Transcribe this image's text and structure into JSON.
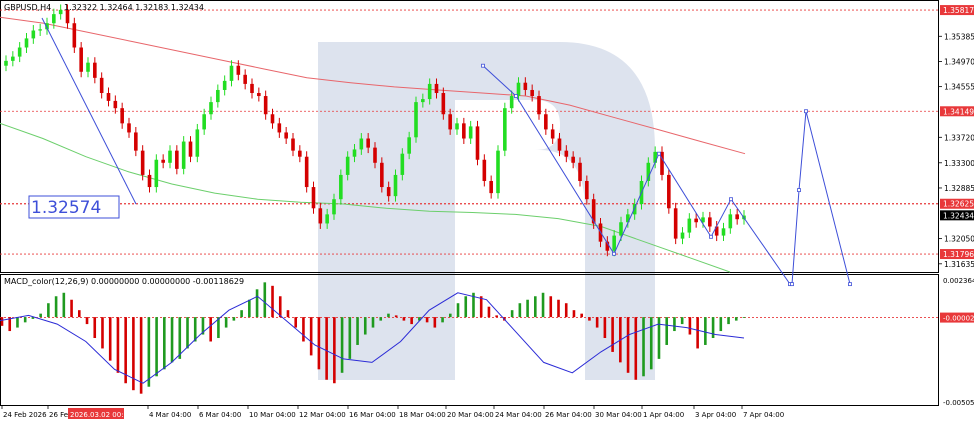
{
  "header": {
    "symbol": "GBPUSD,H4",
    "ohlc": "1.32322 1.32464 1.32183 1.32434",
    "big_price_label": "1.32574"
  },
  "macd_header": "MACD_color(12,26,9) 0.00000000 0.00000000 -0.00118629",
  "x_axis": {
    "labels": [
      "24 Feb 2026",
      "26 Feb",
      "2026.03.02 00:00",
      "4 Mar 04:00",
      "6 Mar 04:00",
      "10 Mar 04:00",
      "12 Mar 04:00",
      "16 Mar 04:00",
      "18 Mar 04:00",
      "20 Mar 04:00",
      "24 Mar 04:00",
      "26 Mar 04:00",
      "30 Mar 04:00",
      "1 Apr 04:00",
      "3 Apr 04:00",
      "7 Apr 04:00"
    ]
  },
  "price_axis": {
    "ticks": [
      "1.35385",
      "1.34970",
      "1.34555",
      "1.33720",
      "1.33300",
      "1.32885",
      "1.32050",
      "1.31635"
    ],
    "tagged": [
      {
        "value": "1.35817",
        "bg": "#e8383a"
      },
      {
        "value": "1.34149",
        "bg": "#e8383a"
      },
      {
        "value": "1.32625",
        "bg": "#e8383a"
      },
      {
        "value": "1.32434",
        "bg": "#000000"
      },
      {
        "value": "1.31796",
        "bg": "#e8383a"
      }
    ]
  },
  "macd_axis": {
    "ticks": [
      "0.0023644",
      "-0.0050508"
    ],
    "tagged": [
      {
        "value": "-0.000026",
        "bg": "#e8383a"
      }
    ]
  },
  "colors": {
    "bull": "#22dd22",
    "bear": "#d40000",
    "ma_slow": "#e8666b",
    "ma_fast": "#6ccf6c",
    "forecast": "#3e4fd8",
    "level": "#e8383a",
    "signal": "#2b2bd6",
    "watermark": "#dde3ee"
  },
  "chart_data": {
    "type": "candlestick",
    "timeframe": "H4",
    "ylim": [
      1.315,
      1.3595
    ],
    "levels": [
      1.35817,
      1.34149,
      1.32625,
      1.31796
    ],
    "current_price": 1.32434,
    "closes": [
      1.3498,
      1.3505,
      1.352,
      1.3535,
      1.3548,
      1.355,
      1.356,
      1.3575,
      1.3582,
      1.356,
      1.352,
      1.348,
      1.3495,
      1.347,
      1.3445,
      1.3432,
      1.342,
      1.3395,
      1.338,
      1.335,
      1.331,
      1.329,
      1.3335,
      1.333,
      1.335,
      1.332,
      1.3365,
      1.334,
      1.3385,
      1.341,
      1.343,
      1.345,
      1.3465,
      1.349,
      1.3475,
      1.346,
      1.3445,
      1.344,
      1.341,
      1.3395,
      1.338,
      1.337,
      1.335,
      1.334,
      1.329,
      1.3255,
      1.323,
      1.3245,
      1.327,
      1.331,
      1.334,
      1.3352,
      1.337,
      1.3355,
      1.333,
      1.329,
      1.3275,
      1.331,
      1.3345,
      1.3372,
      1.343,
      1.3435,
      1.346,
      1.3445,
      1.341,
      1.3385,
      1.3395,
      1.337,
      1.339,
      1.3335,
      1.33,
      1.328,
      1.335,
      1.342,
      1.344,
      1.3462,
      1.345,
      1.344,
      1.341,
      1.3385,
      1.337,
      1.335,
      1.334,
      1.333,
      1.33,
      1.327,
      1.323,
      1.32,
      1.3185,
      1.321,
      1.3232,
      1.3245,
      1.3262,
      1.33,
      1.333,
      1.3348,
      1.331,
      1.3255,
      1.3205,
      1.3215,
      1.3238,
      1.3232,
      1.324,
      1.3225,
      1.321,
      1.3222,
      1.3245,
      1.3237,
      1.3243
    ],
    "ma_slow": [
      1.357,
      1.356,
      1.3545,
      1.353,
      1.3515,
      1.35,
      1.3485,
      1.347,
      1.3462,
      1.3455,
      1.345,
      1.3445,
      1.344,
      1.3425,
      1.3405,
      1.3385,
      1.3365,
      1.3345
    ],
    "ma_fast": [
      1.3395,
      1.337,
      1.334,
      1.3315,
      1.3295,
      1.328,
      1.327,
      1.3265,
      1.3262,
      1.3255,
      1.325,
      1.3248,
      1.3245,
      1.3238,
      1.3225,
      1.32,
      1.3175,
      1.315
    ],
    "forecast": [
      {
        "x": "20 Mar 04:00",
        "y": 1.349
      },
      {
        "x": "24 Mar 04:00",
        "y": 1.344
      },
      {
        "x": "30 Mar 04:00",
        "y": 1.318
      },
      {
        "x": "1 Apr 04:00",
        "y": 1.3345
      },
      {
        "x": "3 Apr 04:00",
        "y": 1.3208
      },
      {
        "x": "7 Apr 04:00",
        "y": 1.327
      },
      {
        "x": "8 Apr",
        "y": 1.313
      },
      {
        "x": "9 Apr",
        "y": 1.313
      },
      {
        "x": "9 Apr",
        "y": 1.3285
      },
      {
        "x": "9 Apr",
        "y": 1.3415
      },
      {
        "x": "10 Apr",
        "y": 1.313
      }
    ],
    "macd": {
      "ylim": [
        -0.0050508,
        0.0023644
      ],
      "hist": [
        -0.0005,
        -0.0008,
        -0.0006,
        -0.0003,
        -0.0001,
        0.0002,
        0.0008,
        0.0012,
        0.0014,
        0.001,
        0.0004,
        -0.0004,
        -0.0012,
        -0.0018,
        -0.0025,
        -0.0032,
        -0.0038,
        -0.0042,
        -0.0044,
        -0.004,
        -0.0034,
        -0.003,
        -0.0026,
        -0.0024,
        -0.0018,
        -0.0014,
        -0.001,
        -0.0014,
        -0.0012,
        -0.0006,
        -0.0002,
        0.0004,
        0.001,
        0.0016,
        0.002,
        0.0018,
        0.0012,
        0.0004,
        -0.0006,
        -0.0014,
        -0.0022,
        -0.003,
        -0.0036,
        -0.0038,
        -0.0032,
        -0.0024,
        -0.0016,
        -0.001,
        -0.0006,
        -0.0002,
        0.0002,
        0.0001,
        -0.0002,
        -0.0004,
        -0.0002,
        -0.0003,
        -0.0006,
        -0.0003,
        0.0002,
        0.0008,
        0.0012,
        0.0014,
        0.0012,
        0.0006,
        0.0001,
        -0.0002,
        0.0004,
        0.0008,
        0.001,
        0.0012,
        0.0014,
        0.0012,
        0.001,
        0.0008,
        0.0004,
        0.0002,
        -0.0002,
        -0.0006,
        -0.0012,
        -0.002,
        -0.0026,
        -0.0032,
        -0.0036,
        -0.0034,
        -0.003,
        -0.0024,
        -0.0016,
        -0.0008,
        -0.0004,
        -0.001,
        -0.0018,
        -0.0016,
        -0.0012,
        -0.0008,
        -0.0004,
        -0.0002,
        0.0
      ],
      "signal": [
        -0.0002,
        0.0001,
        -0.0004,
        -0.0014,
        -0.003,
        -0.0038,
        -0.0026,
        -0.001,
        0.0004,
        0.0012,
        -0.0002,
        -0.0016,
        -0.0024,
        -0.0026,
        -0.0014,
        0.0004,
        0.0014,
        0.001,
        -0.0008,
        -0.0026,
        -0.0032,
        -0.002,
        -0.001,
        -0.0004,
        -0.0006,
        -0.001,
        -0.0012
      ]
    }
  }
}
